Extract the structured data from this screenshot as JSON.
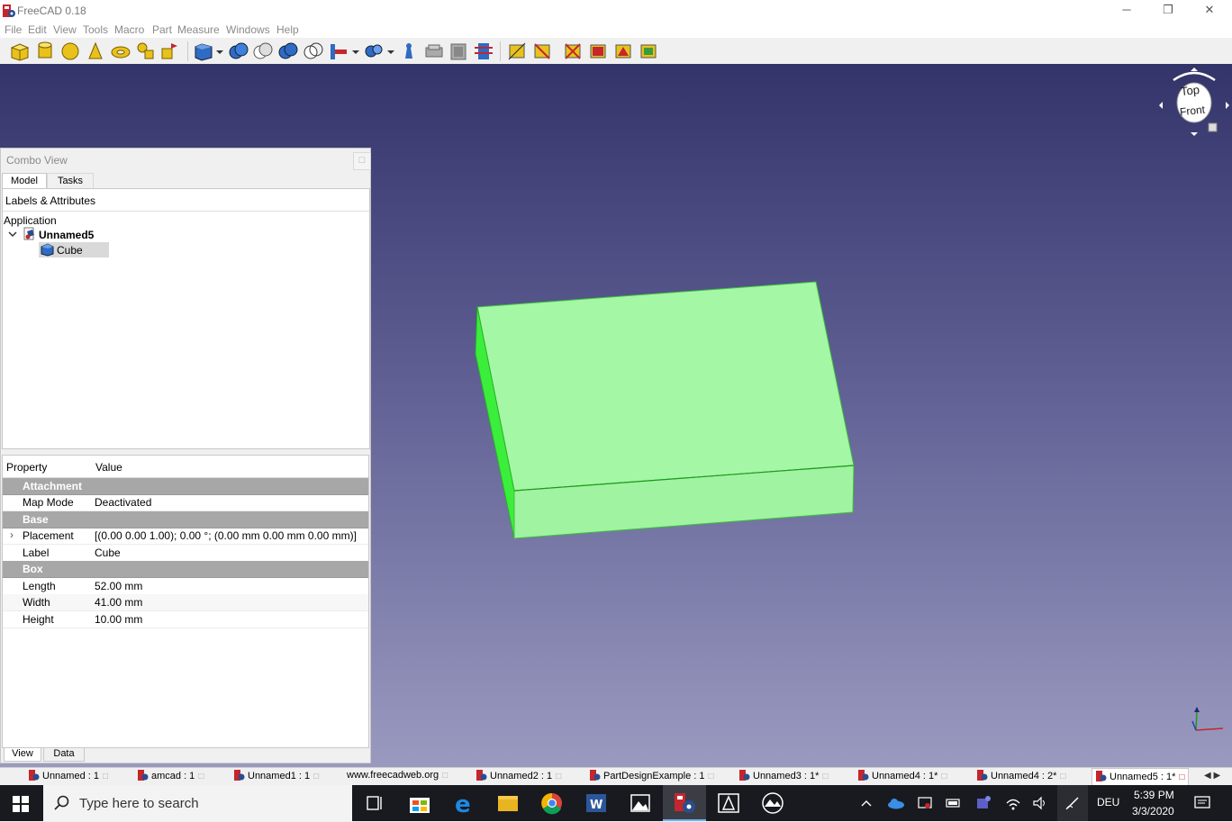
{
  "window": {
    "title": "FreeCAD 0.18",
    "buttons": {
      "minimize": "─",
      "restore": "❐",
      "close": "✕"
    }
  },
  "menu": [
    "File",
    "Edit",
    "View",
    "Tools",
    "Macro",
    "Part",
    "Measure",
    "Windows",
    "Help"
  ],
  "toolbar_icons": [
    "part-box-icon",
    "part-cylinder-icon",
    "part-sphere-icon",
    "part-cone-icon",
    "part-torus-icon",
    "part-tube-icon",
    "part-primitives-icon",
    "part-shape-builder-icon",
    "part-extrude-icon",
    "part-revolve-icon",
    "part-mirror-icon",
    "part-fillet-icon",
    "part-chamfer-icon",
    "part-make-face-icon",
    "part-ruled-surface-icon",
    "part-loft-icon",
    "part-sweep-icon",
    "part-section-icon",
    "part-cross-sections-icon",
    "part-offset-icon",
    "part-thickness-icon",
    "part-projection-icon",
    "part-boolean-icon",
    "part-cut-icon",
    "part-fuse-icon",
    "part-common-icon"
  ],
  "combo_view": {
    "title": "Combo View",
    "close": "□",
    "tabs": [
      "Model",
      "Tasks"
    ],
    "tree": {
      "header": "Labels & Attributes",
      "section": "Application",
      "document": "Unnamed5",
      "object": "Cube"
    },
    "properties": {
      "header": {
        "property": "Property",
        "value": "Value"
      },
      "rows": [
        {
          "type": "group",
          "key": "Attachment"
        },
        {
          "type": "prop",
          "key": "Map Mode",
          "value": "Deactivated"
        },
        {
          "type": "group",
          "key": "Base"
        },
        {
          "type": "prop",
          "key": "Placement",
          "value": "[(0.00 0.00 1.00); 0.00 °; (0.00 mm  0.00 mm  0.00 mm)]",
          "expandable": "›"
        },
        {
          "type": "prop",
          "key": "Label",
          "value": "Cube"
        },
        {
          "type": "group",
          "key": "Box"
        },
        {
          "type": "prop",
          "key": "Length",
          "value": "52.00 mm"
        },
        {
          "type": "prop",
          "key": "Width",
          "value": "41.00 mm"
        },
        {
          "type": "prop",
          "key": "Height",
          "value": "10.00 mm"
        }
      ],
      "bottom_tabs": [
        "View",
        "Data"
      ]
    }
  },
  "navcube": {
    "top": "Top",
    "front": "Front"
  },
  "model_color": "#a4f7a4",
  "doc_tabs": [
    "Unnamed : 1",
    "amcad : 1",
    "Unnamed1 : 1",
    "www.freecadweb.org",
    "Unnamed2 : 1",
    "PartDesignExample : 1",
    "Unnamed3 : 1*",
    "Unnamed4 : 1*",
    "Unnamed4 : 2*",
    "Unnamed5 : 1*"
  ],
  "doc_tabs_close": "□",
  "doc_tabs_nav": "◀ ▶",
  "taskbar": {
    "search_placeholder": "Type here to search",
    "language": "DEU",
    "time": "5:39 PM",
    "date": "3/3/2020",
    "apps": [
      "task-view-icon",
      "store-icon",
      "edge-icon",
      "file-explorer-icon",
      "chrome-icon",
      "word-icon",
      "photos-icon",
      "freecad-icon",
      "autocad-icon",
      "sketch-icon"
    ]
  }
}
